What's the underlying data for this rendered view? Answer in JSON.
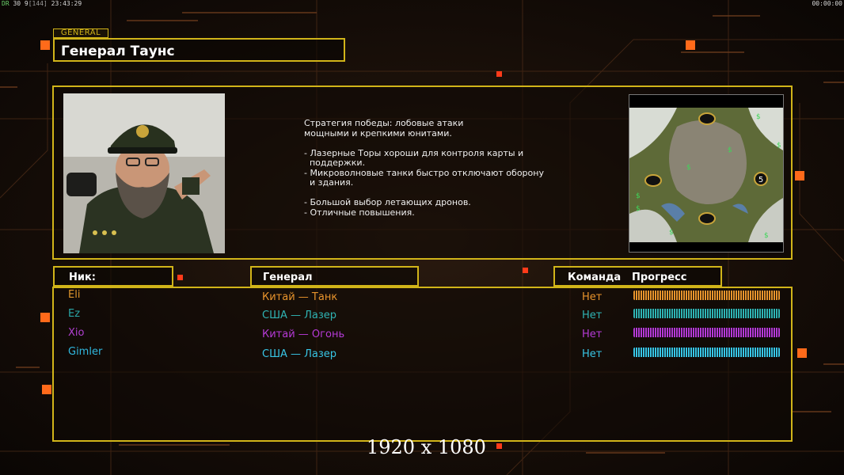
{
  "hud": {
    "fps_label": "DR",
    "fps_stats": "30 9",
    "fps_extra": "[144]",
    "clock": "23:43:29",
    "timer": "00:00:00"
  },
  "general": {
    "tag": "GENERAL",
    "name": "Генерал Таунс",
    "description": [
      "Стратегия победы: лобовые атаки",
      "мощными и крепкими юнитами.",
      "",
      "- Лазерные Торы хороши для контроля карты и",
      "  поддержки.",
      "- Микроволновые танки быстро отключают оборону",
      "  и здания.",
      "",
      "- Большой выбор летающих дронов.",
      "- Отличные повышения."
    ],
    "map_badge": "5"
  },
  "table": {
    "headers": {
      "nick": "Ник:",
      "general": "Генерал",
      "team": "Команда",
      "progress": "Прогресс"
    },
    "rows": [
      {
        "nick": "Eli",
        "general": "Китай — Танк",
        "team": "Нет",
        "progress": 1.0,
        "color": "#e8942c",
        "nick_color": "#e0962c"
      },
      {
        "nick": "Ez",
        "general": "США — Лазер",
        "team": "Нет",
        "progress": 1.0,
        "color": "#2fb4b4",
        "nick_color": "#2aa7a7"
      },
      {
        "nick": "Xio",
        "general": "Китай — Огонь",
        "team": "Нет",
        "progress": 1.0,
        "color": "#b53ad6",
        "nick_color": "#b040d0"
      },
      {
        "nick": "Gimler",
        "general": "США — Лазер",
        "team": "Нет",
        "progress": 1.0,
        "color": "#38c6e6",
        "nick_color": "#30b8e0"
      }
    ]
  },
  "resolution": "1920 x 1080",
  "colors": {
    "accent": "#d1b419",
    "orange": "#ff6a1a"
  }
}
